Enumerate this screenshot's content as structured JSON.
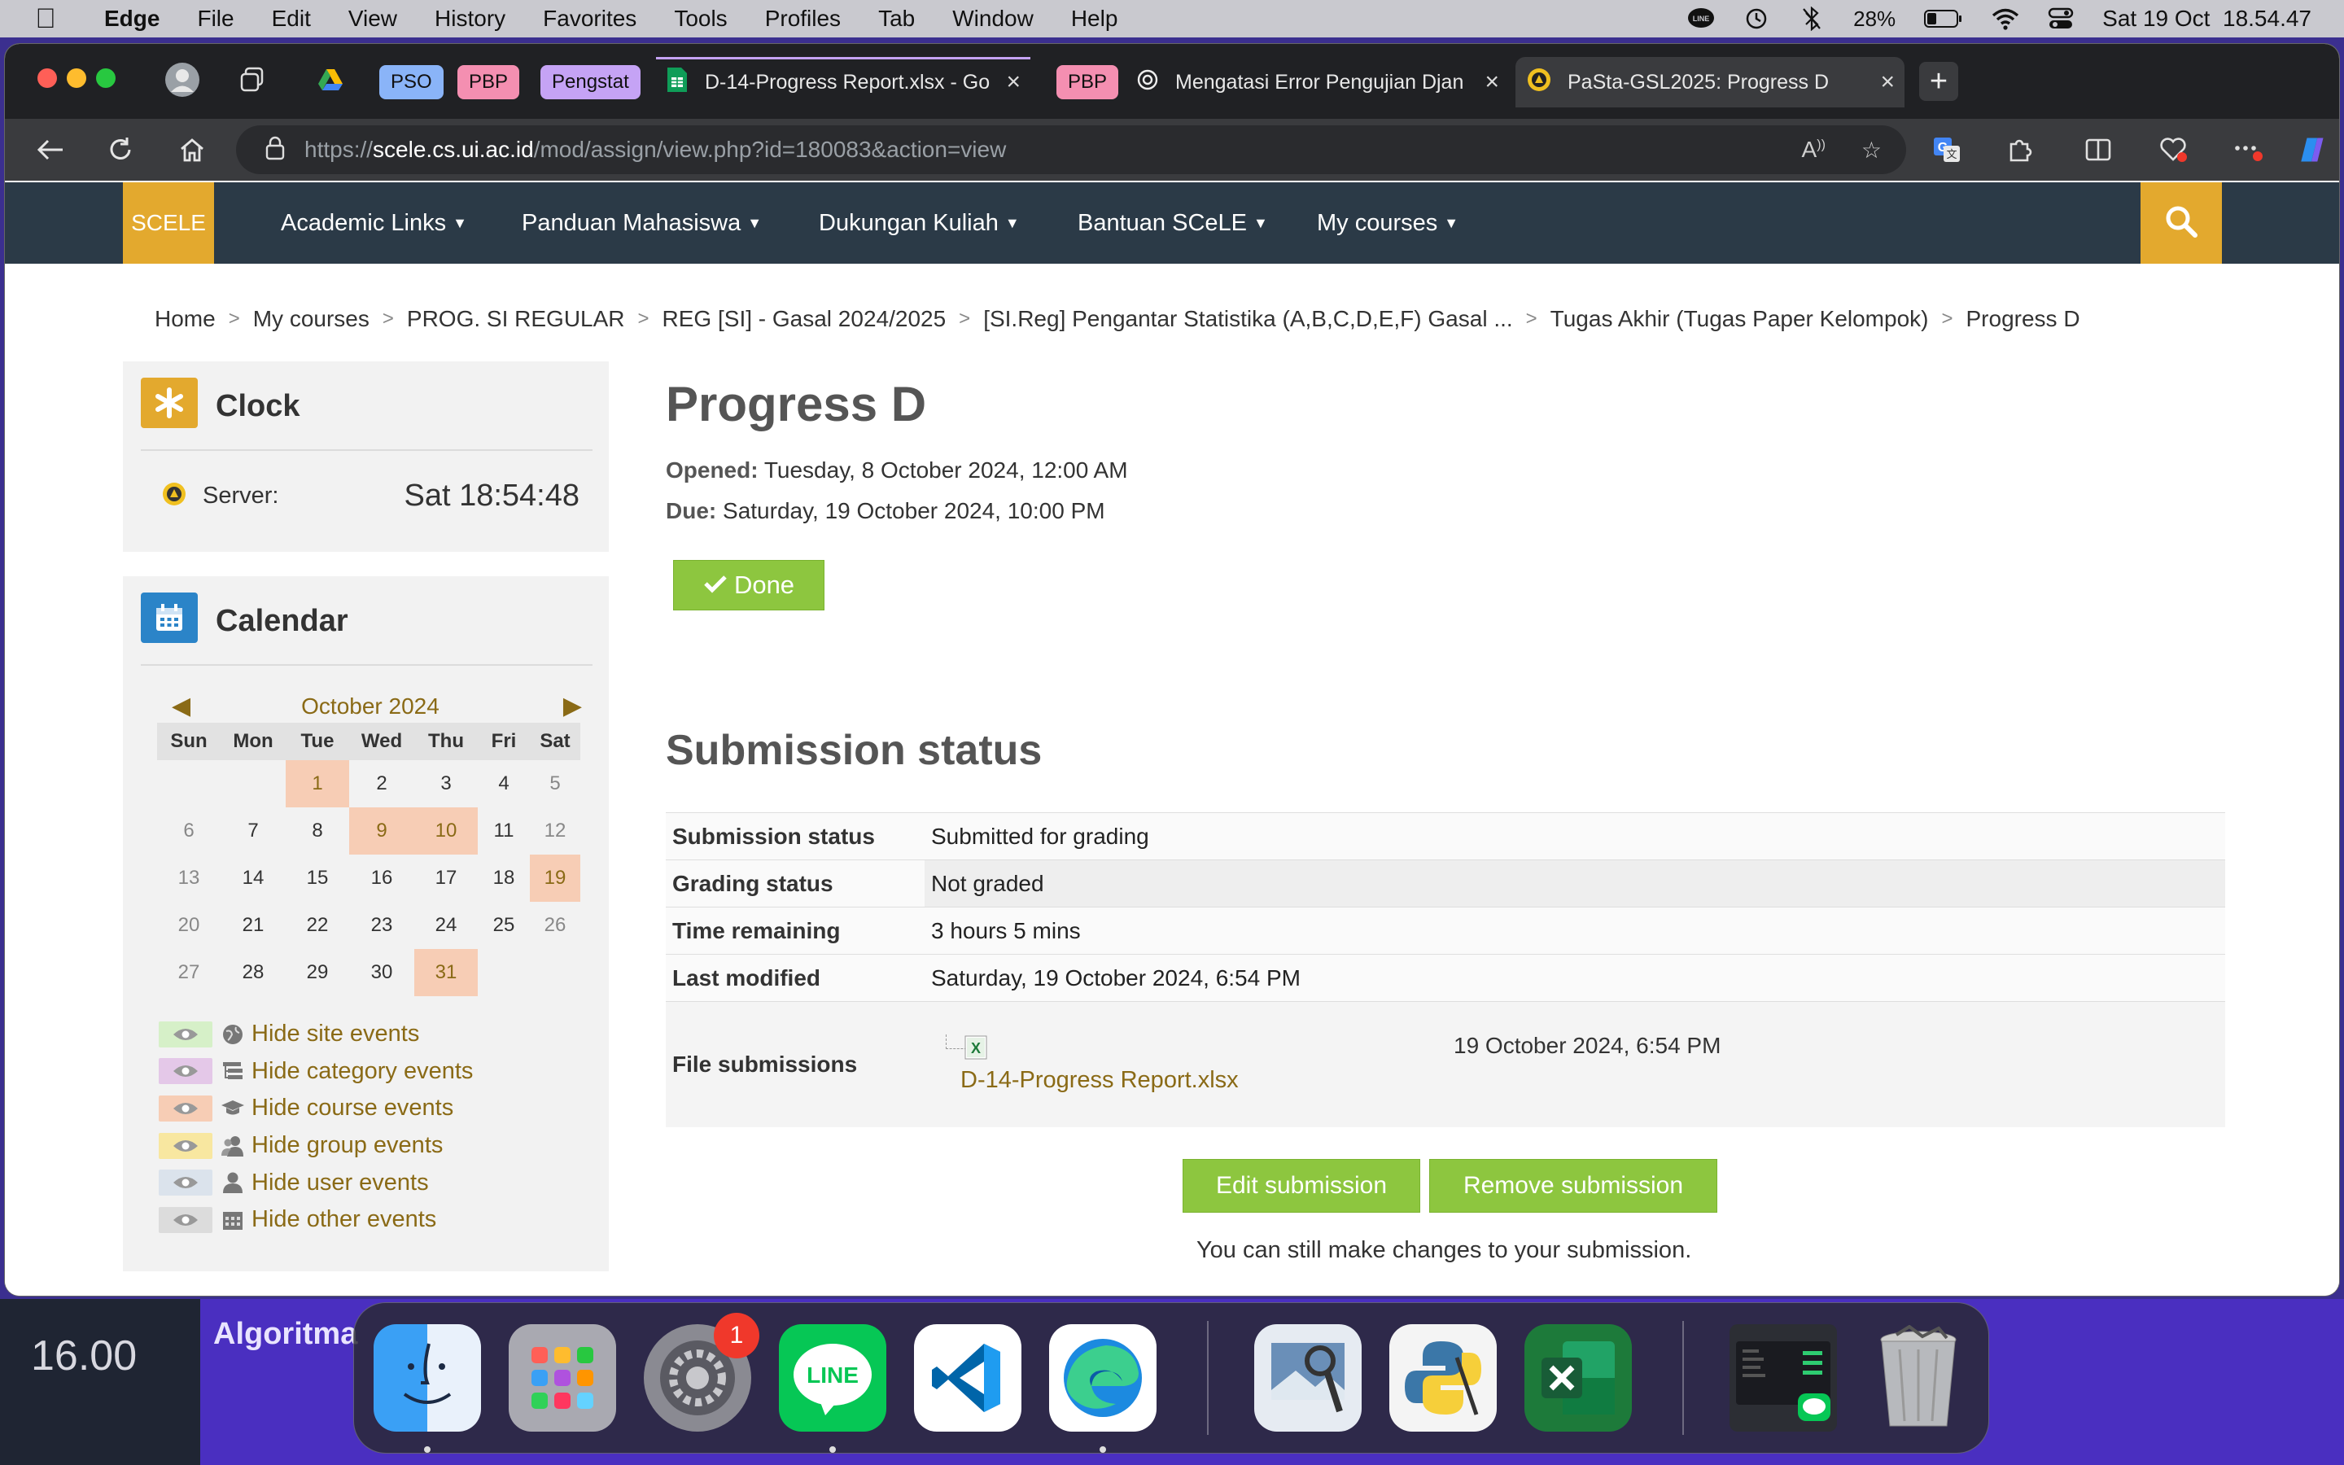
{
  "menubar": {
    "app": "Edge",
    "items": [
      "File",
      "Edit",
      "View",
      "History",
      "Favorites",
      "Tools",
      "Profiles",
      "Tab",
      "Window",
      "Help"
    ],
    "battery": "28%",
    "datetime": "Sat 19 Oct  18.54.47"
  },
  "desktop": {
    "clock": "16.00",
    "label": "Algoritma"
  },
  "browser": {
    "groups": [
      {
        "label": "PSO",
        "color": "#8ab4f8"
      },
      {
        "label": "PBP",
        "color": "#f48fb1"
      },
      {
        "label": "Pengstat",
        "color": "#c5a3f5"
      },
      {
        "label": "PBP",
        "color": "#f48fb1"
      }
    ],
    "tabs": [
      {
        "title": "D-14-Progress Report.xlsx - Go"
      },
      {
        "title": "Mengatasi Error Pengujian Djan"
      },
      {
        "title": "PaSta-GSL2025: Progress D"
      }
    ],
    "url_scheme": "https://",
    "url_host": "scele.cs.ui.ac.id",
    "url_path": "/mod/assign/view.php?id=180083&action=view"
  },
  "site": {
    "brand": "SCELE",
    "nav": [
      "Academic Links",
      "Panduan Mahasiswa",
      "Dukungan Kuliah",
      "Bantuan SCeLE",
      "My courses"
    ],
    "breadcrumb": [
      "Home",
      "My courses",
      "PROG. SI REGULAR",
      "REG [SI] - Gasal 2024/2025",
      "[SI.Reg] Pengantar Statistika (A,B,C,D,E,F) Gasal ...",
      "Tugas Akhir (Tugas Paper Kelompok)",
      "Progress D"
    ]
  },
  "clock_block": {
    "title": "Clock",
    "server_label": "Server:",
    "server_time": "Sat 18:54:48"
  },
  "calendar_block": {
    "title": "Calendar",
    "month": "October 2024",
    "weekdays": [
      "Sun",
      "Mon",
      "Tue",
      "Wed",
      "Thu",
      "Fri",
      "Sat"
    ],
    "first_weekday_index": 2,
    "days_in_month": 31,
    "event_days": [
      1,
      9,
      10,
      19,
      31
    ],
    "legend": [
      {
        "label": "Hide site events",
        "color": "#d6f0c8"
      },
      {
        "label": "Hide category events",
        "color": "#e4c8e8"
      },
      {
        "label": "Hide course events",
        "color": "#f7cdb5"
      },
      {
        "label": "Hide group events",
        "color": "#f8e7a0"
      },
      {
        "label": "Hide user events",
        "color": "#dbe3ec"
      },
      {
        "label": "Hide other events",
        "color": "#dcdcdc"
      }
    ]
  },
  "assignment": {
    "title": "Progress D",
    "opened_label": "Opened:",
    "opened_value": "Tuesday, 8 October 2024, 12:00 AM",
    "due_label": "Due:",
    "due_value": "Saturday, 19 October 2024, 10:00 PM",
    "done_label": "Done",
    "section_title": "Submission status",
    "rows": [
      {
        "k": "Submission status",
        "v": "Submitted for grading"
      },
      {
        "k": "Grading status",
        "v": "Not graded"
      },
      {
        "k": "Time remaining",
        "v": "3 hours 5 mins"
      },
      {
        "k": "Last modified",
        "v": "Saturday, 19 October 2024, 6:54 PM"
      }
    ],
    "file_label": "File submissions",
    "file_name": "D-14-Progress Report.xlsx",
    "file_date": "19 October 2024, 6:54 PM",
    "edit_label": "Edit submission",
    "remove_label": "Remove submission",
    "note": "You can still make changes to your submission."
  },
  "dock": {
    "apps": [
      "finder-icon",
      "launchpad-icon",
      "system-settings-icon",
      "line-icon",
      "vscode-icon",
      "edge-icon",
      "preview-icon",
      "python-launcher-icon",
      "excel-icon",
      "window-preview-icon",
      "trash-icon"
    ],
    "settings_badge": "1",
    "line_label": "LINE"
  }
}
